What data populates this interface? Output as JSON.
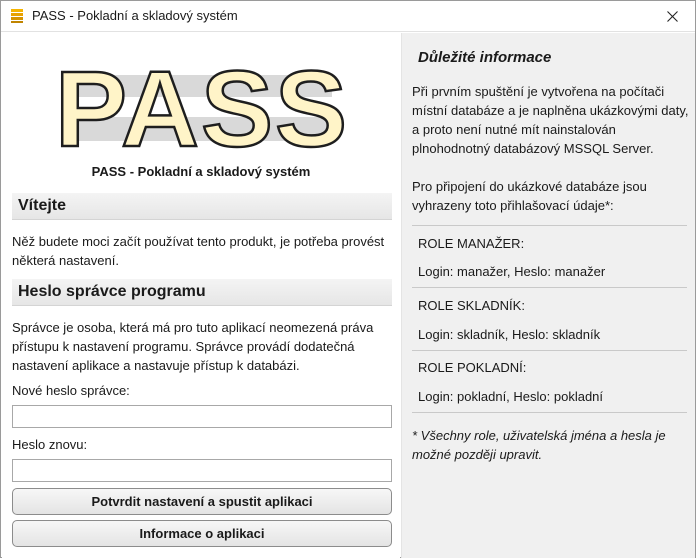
{
  "window": {
    "title": "PASS - Pokladní a skladový systém",
    "close_label": "✕"
  },
  "left": {
    "logo_text": "PASS",
    "product_name": "PASS - Pokladní a skladový systém",
    "welcome": {
      "header": "Vítejte",
      "text": "Něž budete moci začít používat tento produkt, je potřeba provést některá nastavení."
    },
    "admin": {
      "header": "Heslo správce programu",
      "text": "Správce je osoba, která má pro tuto aplikací neomezená práva přístupu k nastavení programu. Správce provádí dodatečná nastavení aplikace a nastavuje přístup k databázi.",
      "new_password_label": "Nové heslo správce:",
      "new_password_value": "",
      "repeat_password_label": "Heslo znovu:",
      "repeat_password_value": ""
    },
    "buttons": {
      "confirm": "Potvrdit nastavení a spustit aplikaci",
      "info": "Informace o aplikaci"
    }
  },
  "right": {
    "title": "Důležité informace",
    "para1": "Při prvním spuštění je vytvořena na počítači místní databáze a je naplněna ukázkovými daty, a proto není nutné mít nainstalován plnohodnotný databázový MSSQL Server.",
    "para2": "Pro připojení do ukázkové databáze jsou vyhrazeny toto přihlašovací údaje*:",
    "roles": [
      {
        "name": "ROLE MANAŽER:",
        "credentials": "Login: manažer, Heslo: manažer"
      },
      {
        "name": "ROLE SKLADNÍK:",
        "credentials": "Login: skladník, Heslo: skladník"
      },
      {
        "name": "ROLE POKLADNÍ:",
        "credentials": "Login: pokladní, Heslo: pokladní"
      }
    ],
    "footnote": "* Všechny role, uživatelská jména a hesla je možné později upravit."
  },
  "colors": {
    "logo_fill": "#fff4c8",
    "logo_stroke": "#1e1e1e",
    "logo_band": "#d9d9d9",
    "right_panel_bg": "#f0f0f0",
    "app_icon": "#e8a200"
  }
}
